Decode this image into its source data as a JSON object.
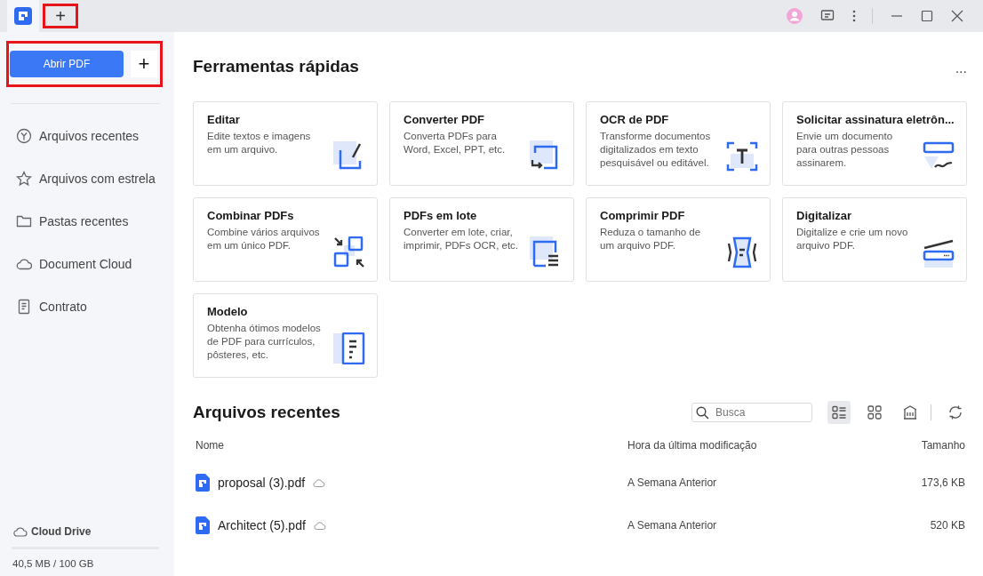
{
  "titlebar": {
    "new_tab": {
      "label": "+",
      "highlighted": true
    }
  },
  "sidebar": {
    "open_button": {
      "label": "Abrir PDF"
    },
    "add_button": {
      "label": "+"
    },
    "highlighted": true,
    "items": [
      {
        "label": "Arquivos recentes",
        "kind": "clock"
      },
      {
        "label": "Arquivos com estrela",
        "kind": "star"
      },
      {
        "label": "Pastas recentes",
        "kind": "folder"
      },
      {
        "label": "Document Cloud",
        "kind": "cloud"
      },
      {
        "label": "Contrato",
        "kind": "doc"
      }
    ],
    "cloud_drive": {
      "label": "Cloud Drive",
      "usage": "40,5 MB / 100 GB",
      "level": 0.0004
    }
  },
  "quick_tools": {
    "title": "Ferramentas rápidas",
    "more": "...",
    "tools": [
      {
        "title": "Editar",
        "description": "Edite textos e imagens em um arquivo.",
        "kind": "edit"
      },
      {
        "title": "Converter PDF",
        "description": "Converta PDFs para Word, Excel, PPT, etc.",
        "kind": "convert"
      },
      {
        "title": "OCR de PDF",
        "description": "Transforme documentos digitalizados em texto pesquisável ou editável.",
        "kind": "ocr"
      },
      {
        "title": "Solicitar assinatura eletrôn...",
        "description": "Envie um documento para outras pessoas assinarem.",
        "kind": "sign"
      },
      {
        "title": "Combinar PDFs",
        "description": "Combine vários arquivos em um único PDF.",
        "kind": "combine"
      },
      {
        "title": "PDFs em lote",
        "description": "Converter em lote, criar, imprimir, PDFs OCR, etc.",
        "kind": "batch"
      },
      {
        "title": "Comprimir PDF",
        "description": "Reduza o tamanho de um arquivo PDF.",
        "kind": "compress"
      },
      {
        "title": "Digitalizar",
        "description": "Digitalize e crie um novo arquivo PDF.",
        "kind": "scan"
      },
      {
        "title": "Modelo",
        "description": "Obtenha ótimos modelos de PDF para currículos, pôsteres, etc.",
        "kind": "template"
      }
    ]
  },
  "recent": {
    "title": "Arquivos recentes",
    "search": {
      "placeholder": "Busca"
    },
    "views": [
      {
        "kind": "list",
        "selected": true
      },
      {
        "kind": "grid",
        "selected": false
      }
    ],
    "columns": [
      "Nome",
      "Hora da última modificação",
      "Tamanho"
    ],
    "rows": [
      {
        "name": "proposal (3).pdf",
        "modified": "A Semana Anterior",
        "size": "173,6 KB"
      },
      {
        "name": "Architect (5).pdf",
        "modified": "A Semana Anterior",
        "size": "520 KB"
      }
    ]
  }
}
